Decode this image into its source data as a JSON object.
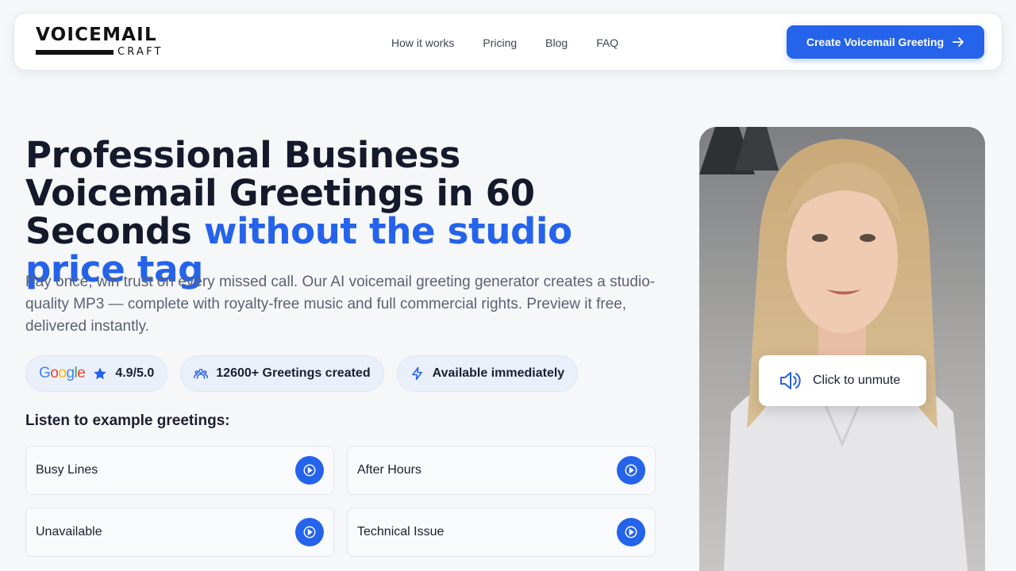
{
  "header": {
    "logo_top": "VOICEMAIL",
    "logo_sub": "CRAFT",
    "nav": [
      "How it works",
      "Pricing",
      "Blog",
      "FAQ"
    ],
    "cta_label": "Create Voicemail Greeting"
  },
  "hero": {
    "headline_main": "Professional Business Voicemail Greetings in 60 Seconds",
    "headline_accent": "without the studio price tag",
    "subtitle": "Pay once, win trust on every missed call. Our AI voicemail greeting generator creates a studio-quality MP3 — complete with royalty-free music and full commercial rights. Preview it free, delivered instantly.",
    "badges": {
      "google_word": "Google",
      "rating": "4.9/5.0",
      "greetings": "12600+ Greetings created",
      "availability": "Available immediately"
    },
    "listen_heading": "Listen to example greetings:",
    "examples": [
      "Busy Lines",
      "After Hours",
      "Unavailable",
      "Technical Issue"
    ]
  },
  "video": {
    "unmute_label": "Click to unmute"
  },
  "colors": {
    "accent": "#2563eb",
    "text": "#141a2b",
    "muted_text": "#5a6272",
    "background": "#f6f7f9"
  }
}
